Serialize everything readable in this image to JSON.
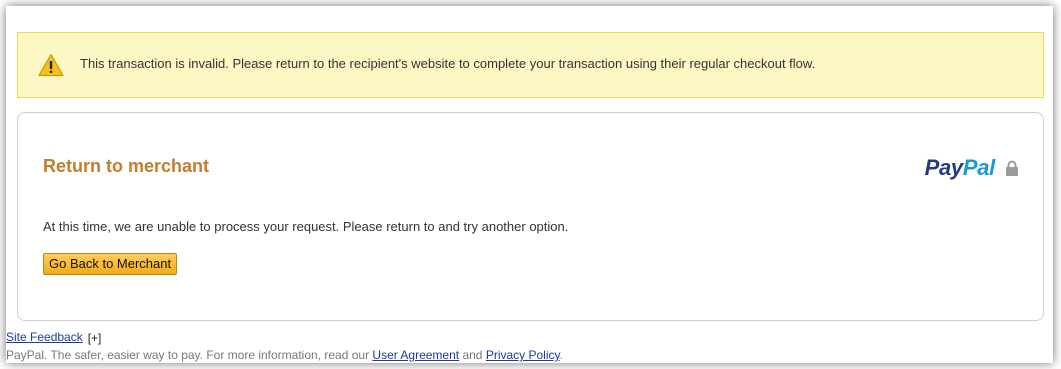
{
  "alert": {
    "icon": "warning-icon",
    "message": "This transaction is invalid. Please return to the recipient's website to complete your transaction using their regular checkout flow.",
    "background_color": "#fdf7c4",
    "border_color": "#f2d950"
  },
  "panel": {
    "title": "Return to merchant",
    "title_color": "#c27d2e",
    "brand": {
      "pay": "Pay",
      "pal": "Pal",
      "lock_icon": "lock-icon"
    },
    "message": "At this time, we are unable to process your request. Please return to and try another option.",
    "button_label": "Go Back to Merchant"
  },
  "footer": {
    "feedback_link": "Site Feedback",
    "feedback_icon": "[+]",
    "legal_prefix": "PayPal. The safer, easier way to pay. For more information, read our ",
    "user_agreement": "User Agreement",
    "and": " and ",
    "privacy_policy": "Privacy Policy",
    "suffix": "."
  }
}
